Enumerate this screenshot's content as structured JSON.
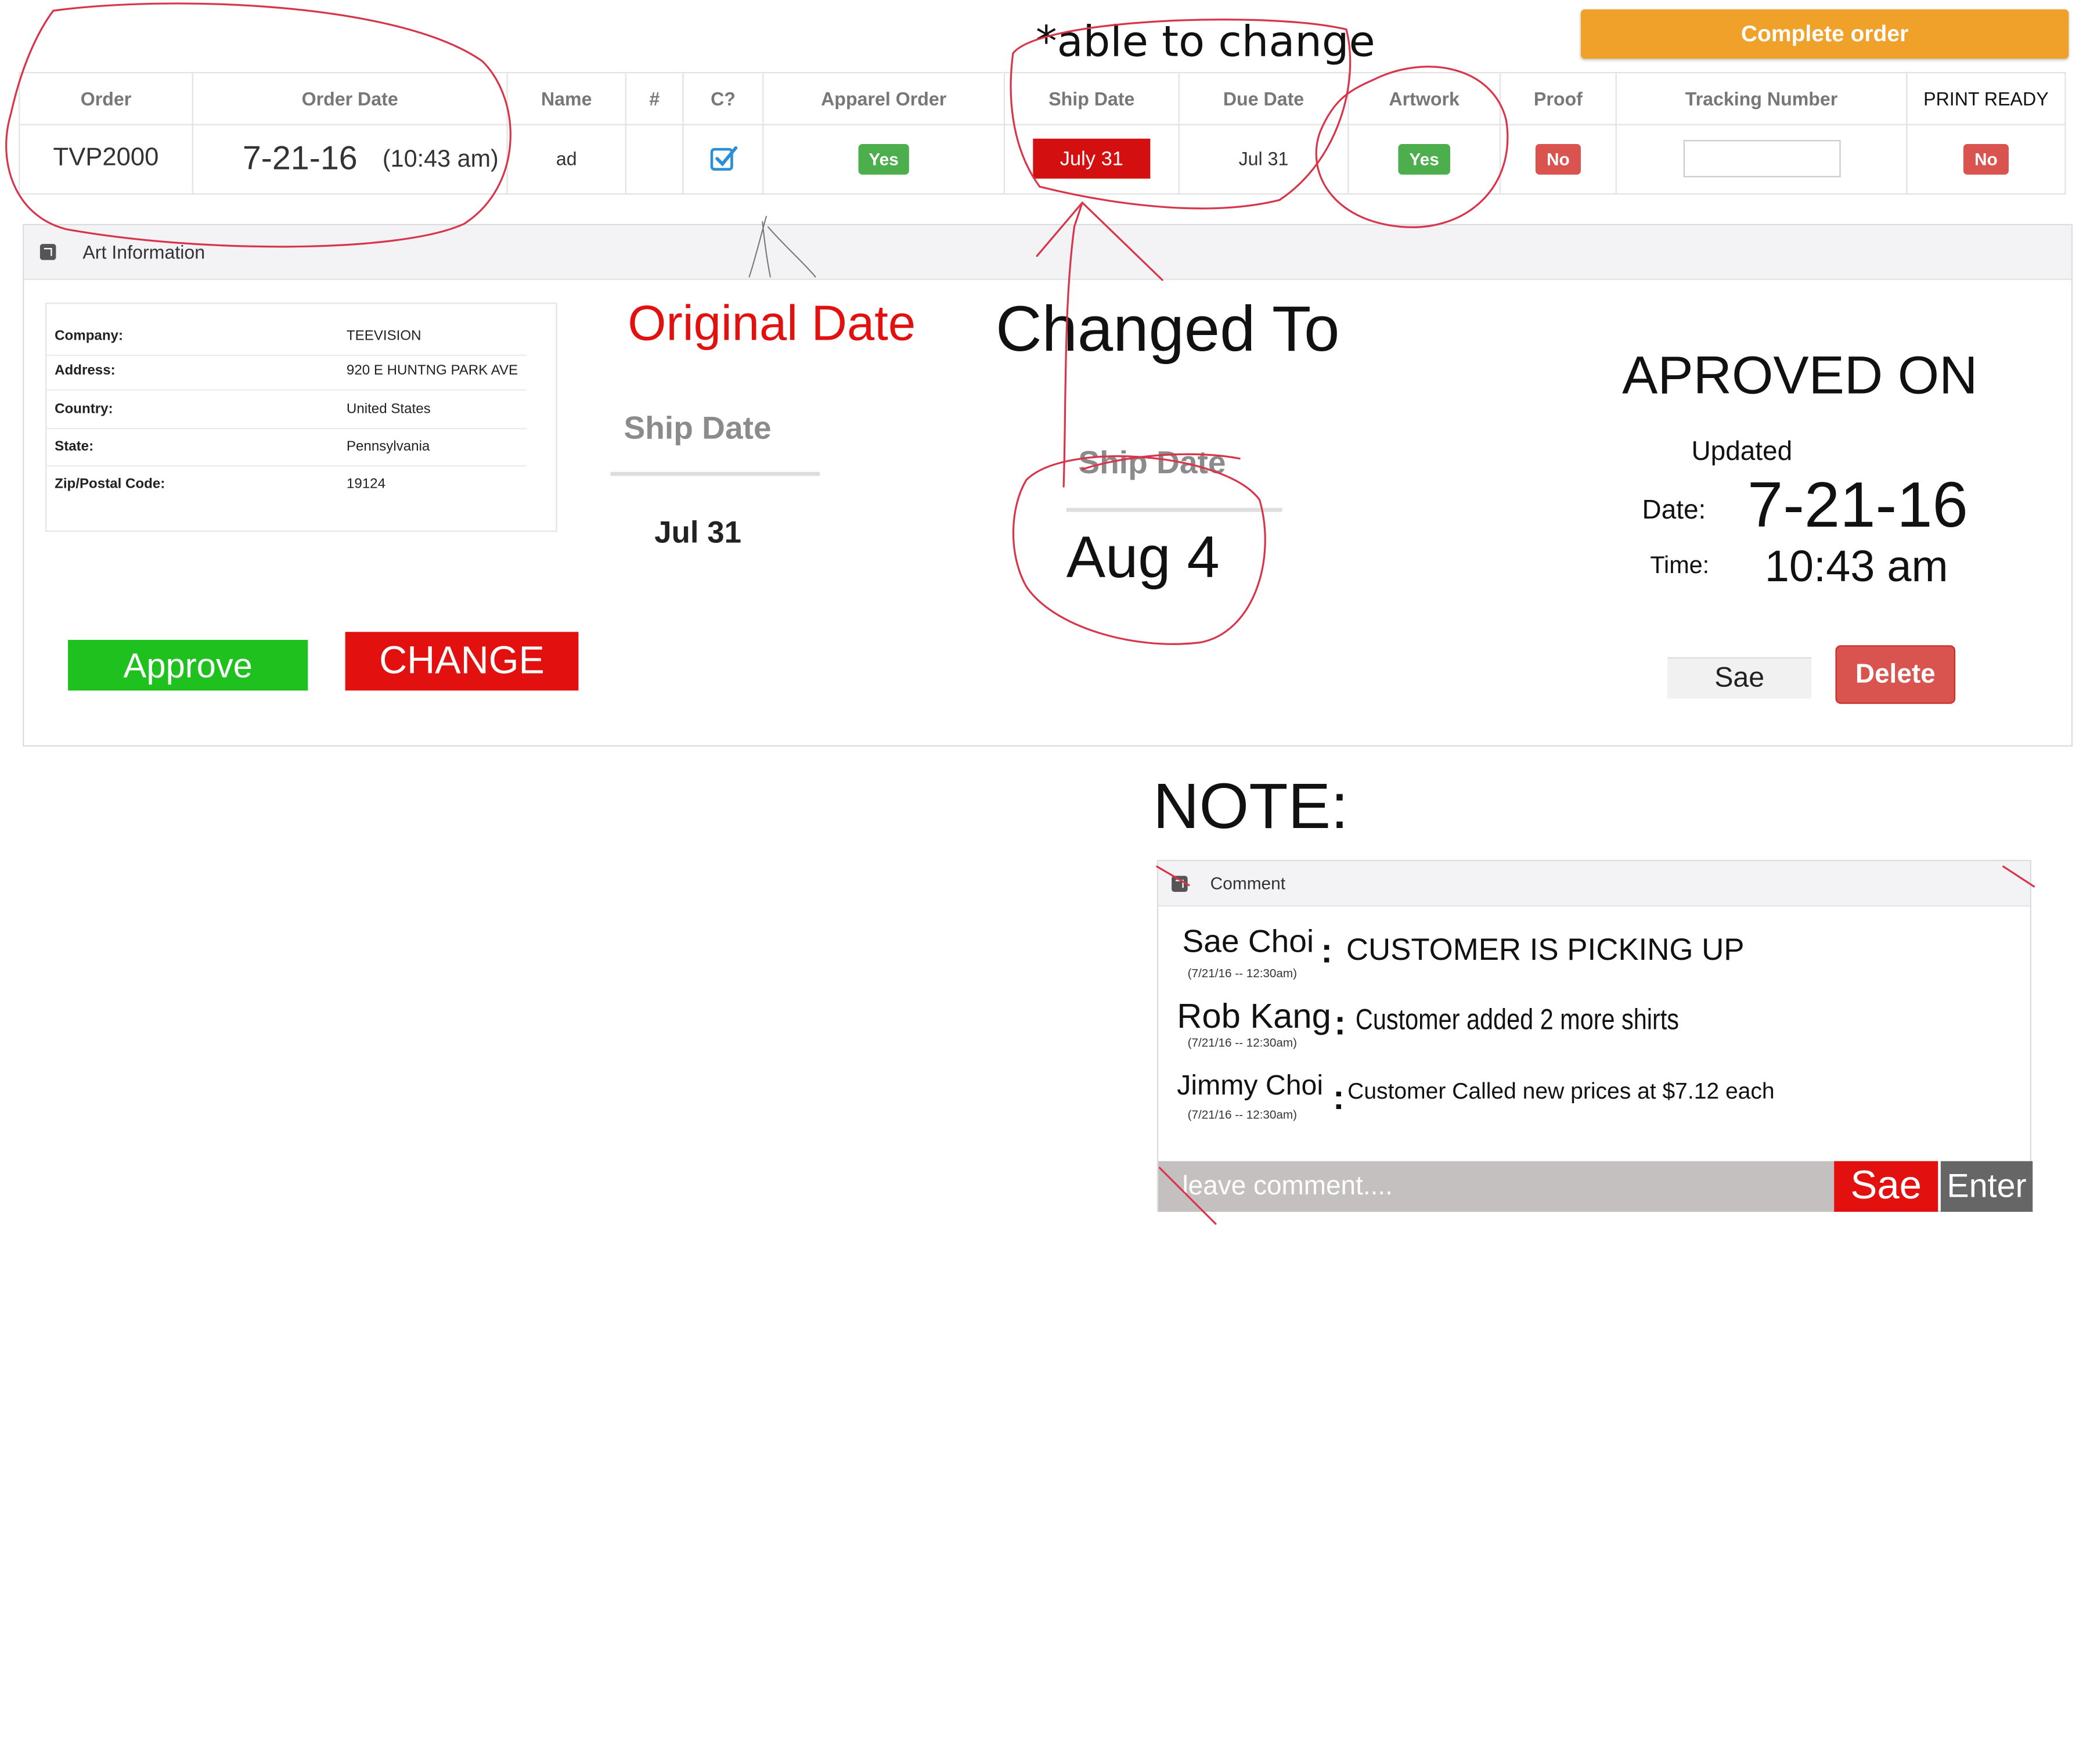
{
  "complete_order_label": "Complete order",
  "top_note": "*able to change",
  "table": {
    "headers": [
      "Order",
      "Order Date",
      "Name",
      "#",
      "C?",
      "Apparel Order",
      "Ship Date",
      "Due Date",
      "Artwork",
      "Proof",
      "Tracking Number",
      "PRINT READY"
    ],
    "row": {
      "order": "TVP2000",
      "order_date": "7-21-16",
      "order_time": "(10:43 am)",
      "name": "ad",
      "num": "",
      "c_checked": true,
      "apparel_order": "Yes",
      "ship_date": "July 31",
      "due_date": "Jul 31",
      "artwork": "Yes",
      "proof": "No",
      "tracking_number": "",
      "print_ready": "No"
    }
  },
  "art_panel": {
    "title": "Art Information",
    "info": [
      {
        "label": "Company:",
        "value": "TEEVISION"
      },
      {
        "label": "Address:",
        "value": "920 E HUNTNG PARK AVE"
      },
      {
        "label": "Country:",
        "value": "United States"
      },
      {
        "label": "State:",
        "value": "Pennsylvania"
      },
      {
        "label": "Zip/Postal Code:",
        "value": "19124"
      }
    ],
    "approve_label": "Approve",
    "change_label": "CHANGE",
    "original_date_title": "Original Date",
    "original_ship_header": "Ship Date",
    "original_ship_value": "Jul 31",
    "changed_to_title": "Changed To",
    "changed_ship_header": "Ship Date",
    "changed_ship_value": "Aug 4",
    "approved_title": "APROVED ON",
    "updated_label": "Updated",
    "date_label": "Date:",
    "date_value": "7-21-16",
    "time_label": "Time:",
    "time_value": "10:43 am",
    "sae_label": "Sae",
    "delete_label": "Delete"
  },
  "note_title": "NOTE:",
  "comments": {
    "title": "Comment",
    "items": [
      {
        "author": "Sae Choi",
        "time": "(7/21/16 -- 12:30am)",
        "text": "CUSTOMER IS PICKING UP"
      },
      {
        "author": "Rob Kang",
        "time": "(7/21/16 -- 12:30am)",
        "text": "Customer  added 2 more shirts"
      },
      {
        "author": "Jimmy Choi",
        "time": "(7/21/16 -- 12:30am)",
        "text": "Customer Called new prices at $7.12 each"
      }
    ],
    "input_placeholder": "leave comment....",
    "sae_label": "Sae",
    "enter_label": "Enter"
  },
  "colors": {
    "orange": "#f0a129",
    "red": "#e31010",
    "green": "#1ec11e",
    "badge_green": "#4cae4c",
    "badge_red": "#d9534f",
    "annotation_red": "#d8344a"
  }
}
